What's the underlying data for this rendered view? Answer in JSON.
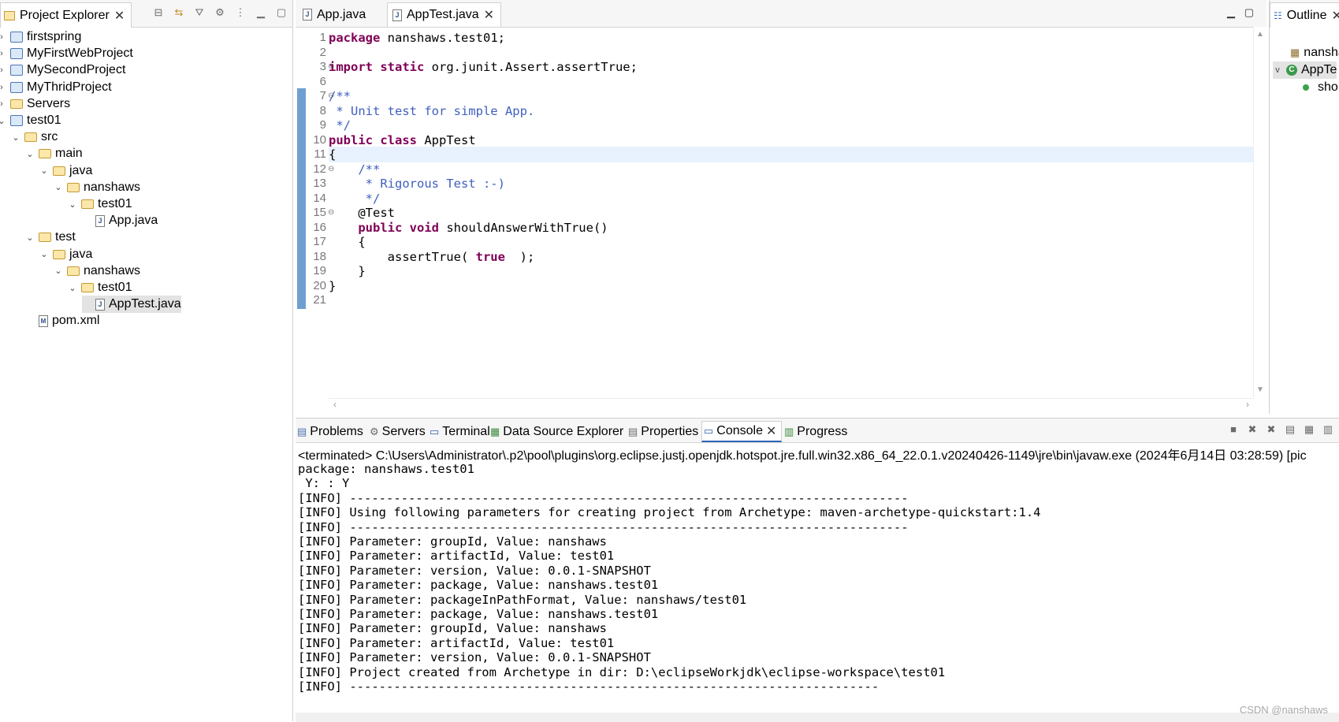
{
  "project_explorer": {
    "title": "Project Explorer",
    "tree": [
      {
        "label": "firstspring",
        "kind": "project",
        "level": 0,
        "twisty": ">"
      },
      {
        "label": "MyFirstWebProject",
        "kind": "project",
        "level": 0,
        "twisty": ">"
      },
      {
        "label": "MySecondProject",
        "kind": "project",
        "level": 0,
        "twisty": ">"
      },
      {
        "label": "MyThridProject",
        "kind": "project",
        "level": 0,
        "twisty": ">"
      },
      {
        "label": "Servers",
        "kind": "folder",
        "level": 0,
        "twisty": ">"
      },
      {
        "label": "test01",
        "kind": "project",
        "level": 0,
        "twisty": "v"
      },
      {
        "label": "src",
        "kind": "folder",
        "level": 1,
        "twisty": "v"
      },
      {
        "label": "main",
        "kind": "folder",
        "level": 2,
        "twisty": "v"
      },
      {
        "label": "java",
        "kind": "folder",
        "level": 3,
        "twisty": "v"
      },
      {
        "label": "nanshaws",
        "kind": "folder",
        "level": 4,
        "twisty": "v"
      },
      {
        "label": "test01",
        "kind": "folder",
        "level": 5,
        "twisty": "v"
      },
      {
        "label": "App.java",
        "kind": "java",
        "level": 6,
        "twisty": ""
      },
      {
        "label": "test",
        "kind": "folder",
        "level": 2,
        "twisty": "v"
      },
      {
        "label": "java",
        "kind": "folder",
        "level": 3,
        "twisty": "v"
      },
      {
        "label": "nanshaws",
        "kind": "folder",
        "level": 4,
        "twisty": "v"
      },
      {
        "label": "test01",
        "kind": "folder",
        "level": 5,
        "twisty": "v"
      },
      {
        "label": "AppTest.java",
        "kind": "java",
        "level": 6,
        "twisty": "",
        "selected": true
      },
      {
        "label": "pom.xml",
        "kind": "xml",
        "level": 2,
        "twisty": ""
      }
    ]
  },
  "editor": {
    "tabs": [
      {
        "label": "App.java",
        "active": false
      },
      {
        "label": "AppTest.java",
        "active": true
      }
    ],
    "lines": [
      {
        "n": "1",
        "fold": "",
        "parts": [
          [
            "kw",
            "package"
          ],
          [
            "",
            "nanshaws.test01;"
          ]
        ]
      },
      {
        "n": "2",
        "fold": "",
        "parts": []
      },
      {
        "n": "3",
        "fold": "⊕",
        "parts": [
          [
            "kw",
            "import static"
          ],
          [
            "",
            "org.junit.Assert.assertTrue;"
          ]
        ]
      },
      {
        "n": "6",
        "fold": "",
        "parts": []
      },
      {
        "n": "7",
        "fold": "⊖",
        "parts": [
          [
            "cm",
            "/**"
          ]
        ]
      },
      {
        "n": "8",
        "fold": "",
        "parts": [
          [
            "cm",
            " * Unit test for simple App."
          ]
        ]
      },
      {
        "n": "9",
        "fold": "",
        "parts": [
          [
            "cm",
            " */"
          ]
        ]
      },
      {
        "n": "10",
        "fold": "",
        "parts": [
          [
            "kw",
            "public class"
          ],
          [
            "",
            "AppTest"
          ]
        ]
      },
      {
        "n": "11",
        "fold": "",
        "parts": [
          [
            "",
            "{"
          ]
        ]
      },
      {
        "n": "12",
        "fold": "⊖",
        "parts": [
          [
            "cm",
            "    /**"
          ]
        ]
      },
      {
        "n": "13",
        "fold": "",
        "parts": [
          [
            "cm",
            "     * Rigorous Test :-)"
          ]
        ]
      },
      {
        "n": "14",
        "fold": "",
        "parts": [
          [
            "cm",
            "     */"
          ]
        ]
      },
      {
        "n": "15",
        "fold": "⊖",
        "parts": [
          [
            "",
            "    @Test"
          ]
        ]
      },
      {
        "n": "16",
        "fold": "",
        "parts": [
          [
            "kw",
            "    public void"
          ],
          [
            "",
            "shouldAnswerWithTrue()"
          ]
        ]
      },
      {
        "n": "17",
        "fold": "",
        "parts": [
          [
            "",
            "    {"
          ]
        ]
      },
      {
        "n": "18",
        "fold": "",
        "parts": [
          [
            "",
            "        assertTrue( "
          ],
          [
            "kw",
            "true"
          ],
          [
            "",
            " );"
          ]
        ]
      },
      {
        "n": "19",
        "fold": "",
        "parts": [
          [
            "",
            "    }"
          ]
        ]
      },
      {
        "n": "20",
        "fold": "",
        "parts": [
          [
            "",
            "}"
          ]
        ]
      },
      {
        "n": "21",
        "fold": "",
        "parts": []
      }
    ]
  },
  "outline": {
    "title": "Outline",
    "items": [
      {
        "label": "nansha"
      },
      {
        "label": "AppTe"
      },
      {
        "label": "sho"
      }
    ]
  },
  "console_view": {
    "tabs": [
      {
        "label": "Problems",
        "active": false
      },
      {
        "label": "Servers",
        "active": false
      },
      {
        "label": "Terminal",
        "active": false
      },
      {
        "label": "Data Source Explorer",
        "active": false
      },
      {
        "label": "Properties",
        "active": false
      },
      {
        "label": "Console",
        "active": true
      },
      {
        "label": "Progress",
        "active": false
      }
    ],
    "header": "<terminated> C:\\Users\\Administrator\\.p2\\pool\\plugins\\org.eclipse.justj.openjdk.hotspot.jre.full.win32.x86_64_22.0.1.v20240426-1149\\jre\\bin\\javaw.exe (2024年6月14日 03:28:59) [pic",
    "output": [
      "package: nanshaws.test01",
      " Y: : Y",
      "[INFO] ----------------------------------------------------------------------------",
      "[INFO] Using following parameters for creating project from Archetype: maven-archetype-quickstart:1.4",
      "[INFO] ----------------------------------------------------------------------------",
      "[INFO] Parameter: groupId, Value: nanshaws",
      "[INFO] Parameter: artifactId, Value: test01",
      "[INFO] Parameter: version, Value: 0.0.1-SNAPSHOT",
      "[INFO] Parameter: package, Value: nanshaws.test01",
      "[INFO] Parameter: packageInPathFormat, Value: nanshaws/test01",
      "[INFO] Parameter: package, Value: nanshaws.test01",
      "[INFO] Parameter: groupId, Value: nanshaws",
      "[INFO] Parameter: artifactId, Value: test01",
      "[INFO] Parameter: version, Value: 0.0.1-SNAPSHOT",
      "[INFO] Project created from Archetype in dir: D:\\eclipseWorkjdk\\eclipse-workspace\\test01",
      "[INFO] ------------------------------------------------------------------------"
    ]
  },
  "watermark": "CSDN @nanshaws",
  "colors": {
    "keyword": "#7f0055",
    "comment": "#3f5fbf",
    "current_line": "#e8f2fe",
    "ruler": "#6f9fd0"
  }
}
